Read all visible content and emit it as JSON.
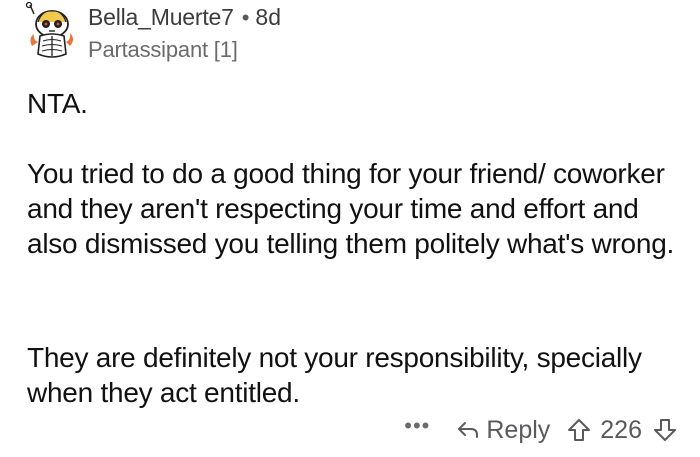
{
  "comment": {
    "author": "Bella_Muerte7",
    "separator": "•",
    "age": "8d",
    "flair": "Partassipant [1]",
    "paragraphs": [
      "NTA.",
      "You tried to do a good thing for your friend/ coworker and they aren't respecting your time and effort and also dismissed you telling them politely what's wrong.",
      "They are definitely not your responsibility, specially when they act entitled."
    ],
    "actions": {
      "more": "•••",
      "reply": "Reply",
      "score": "226"
    }
  },
  "icons": {
    "avatar": "skeleton-avatar",
    "reply": "reply-arrow-icon",
    "upvote": "upvote-arrow-icon",
    "downvote": "downvote-arrow-icon"
  },
  "colors": {
    "text": "#111111",
    "meta": "#3c3c3e",
    "muted": "#5a5a5c"
  }
}
